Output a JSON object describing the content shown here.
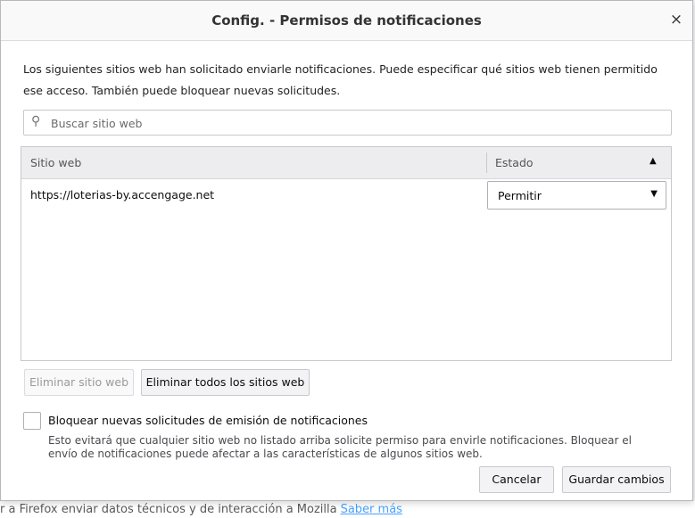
{
  "background": {
    "behind_text": "r a Firefox enviar datos técnicos y de interacción a Mozilla",
    "behind_link": "Saber más"
  },
  "dialog": {
    "title": "Config. - Permisos de notificaciones",
    "close_glyph": "×",
    "description": "Los siguientes sitios web han solicitado enviarle notificaciones. Puede especificar qué sitios web tienen permitido ese acceso. También puede bloquear nuevas solicitudes."
  },
  "search": {
    "placeholder": "Buscar sitio web",
    "value": "",
    "icon": "search-icon"
  },
  "table": {
    "columns": {
      "site": "Sitio web",
      "status": "Estado"
    },
    "sort_glyph": "▲",
    "rows": [
      {
        "site": "https://loterias-by.accengage.net",
        "status": "Permitir"
      }
    ],
    "dropdown_glyph": "▼"
  },
  "buttons": {
    "remove_site": "Eliminar sitio web",
    "remove_all": "Eliminar todos los sitios web",
    "cancel": "Cancelar",
    "save": "Guardar cambios"
  },
  "block_option": {
    "checked": false,
    "label": "Bloquear nuevas solicitudes de emisión de notificaciones",
    "description": "Esto evitará que cualquier sitio web no listado arriba solicite permiso para envirle notificaciones. Bloquear el envío de notificaciones puede afectar a las características de algunos sitios web."
  },
  "colors": {
    "accent": "#0a84ff",
    "header_bg": "#ededf0",
    "border": "#c8c8cd"
  }
}
